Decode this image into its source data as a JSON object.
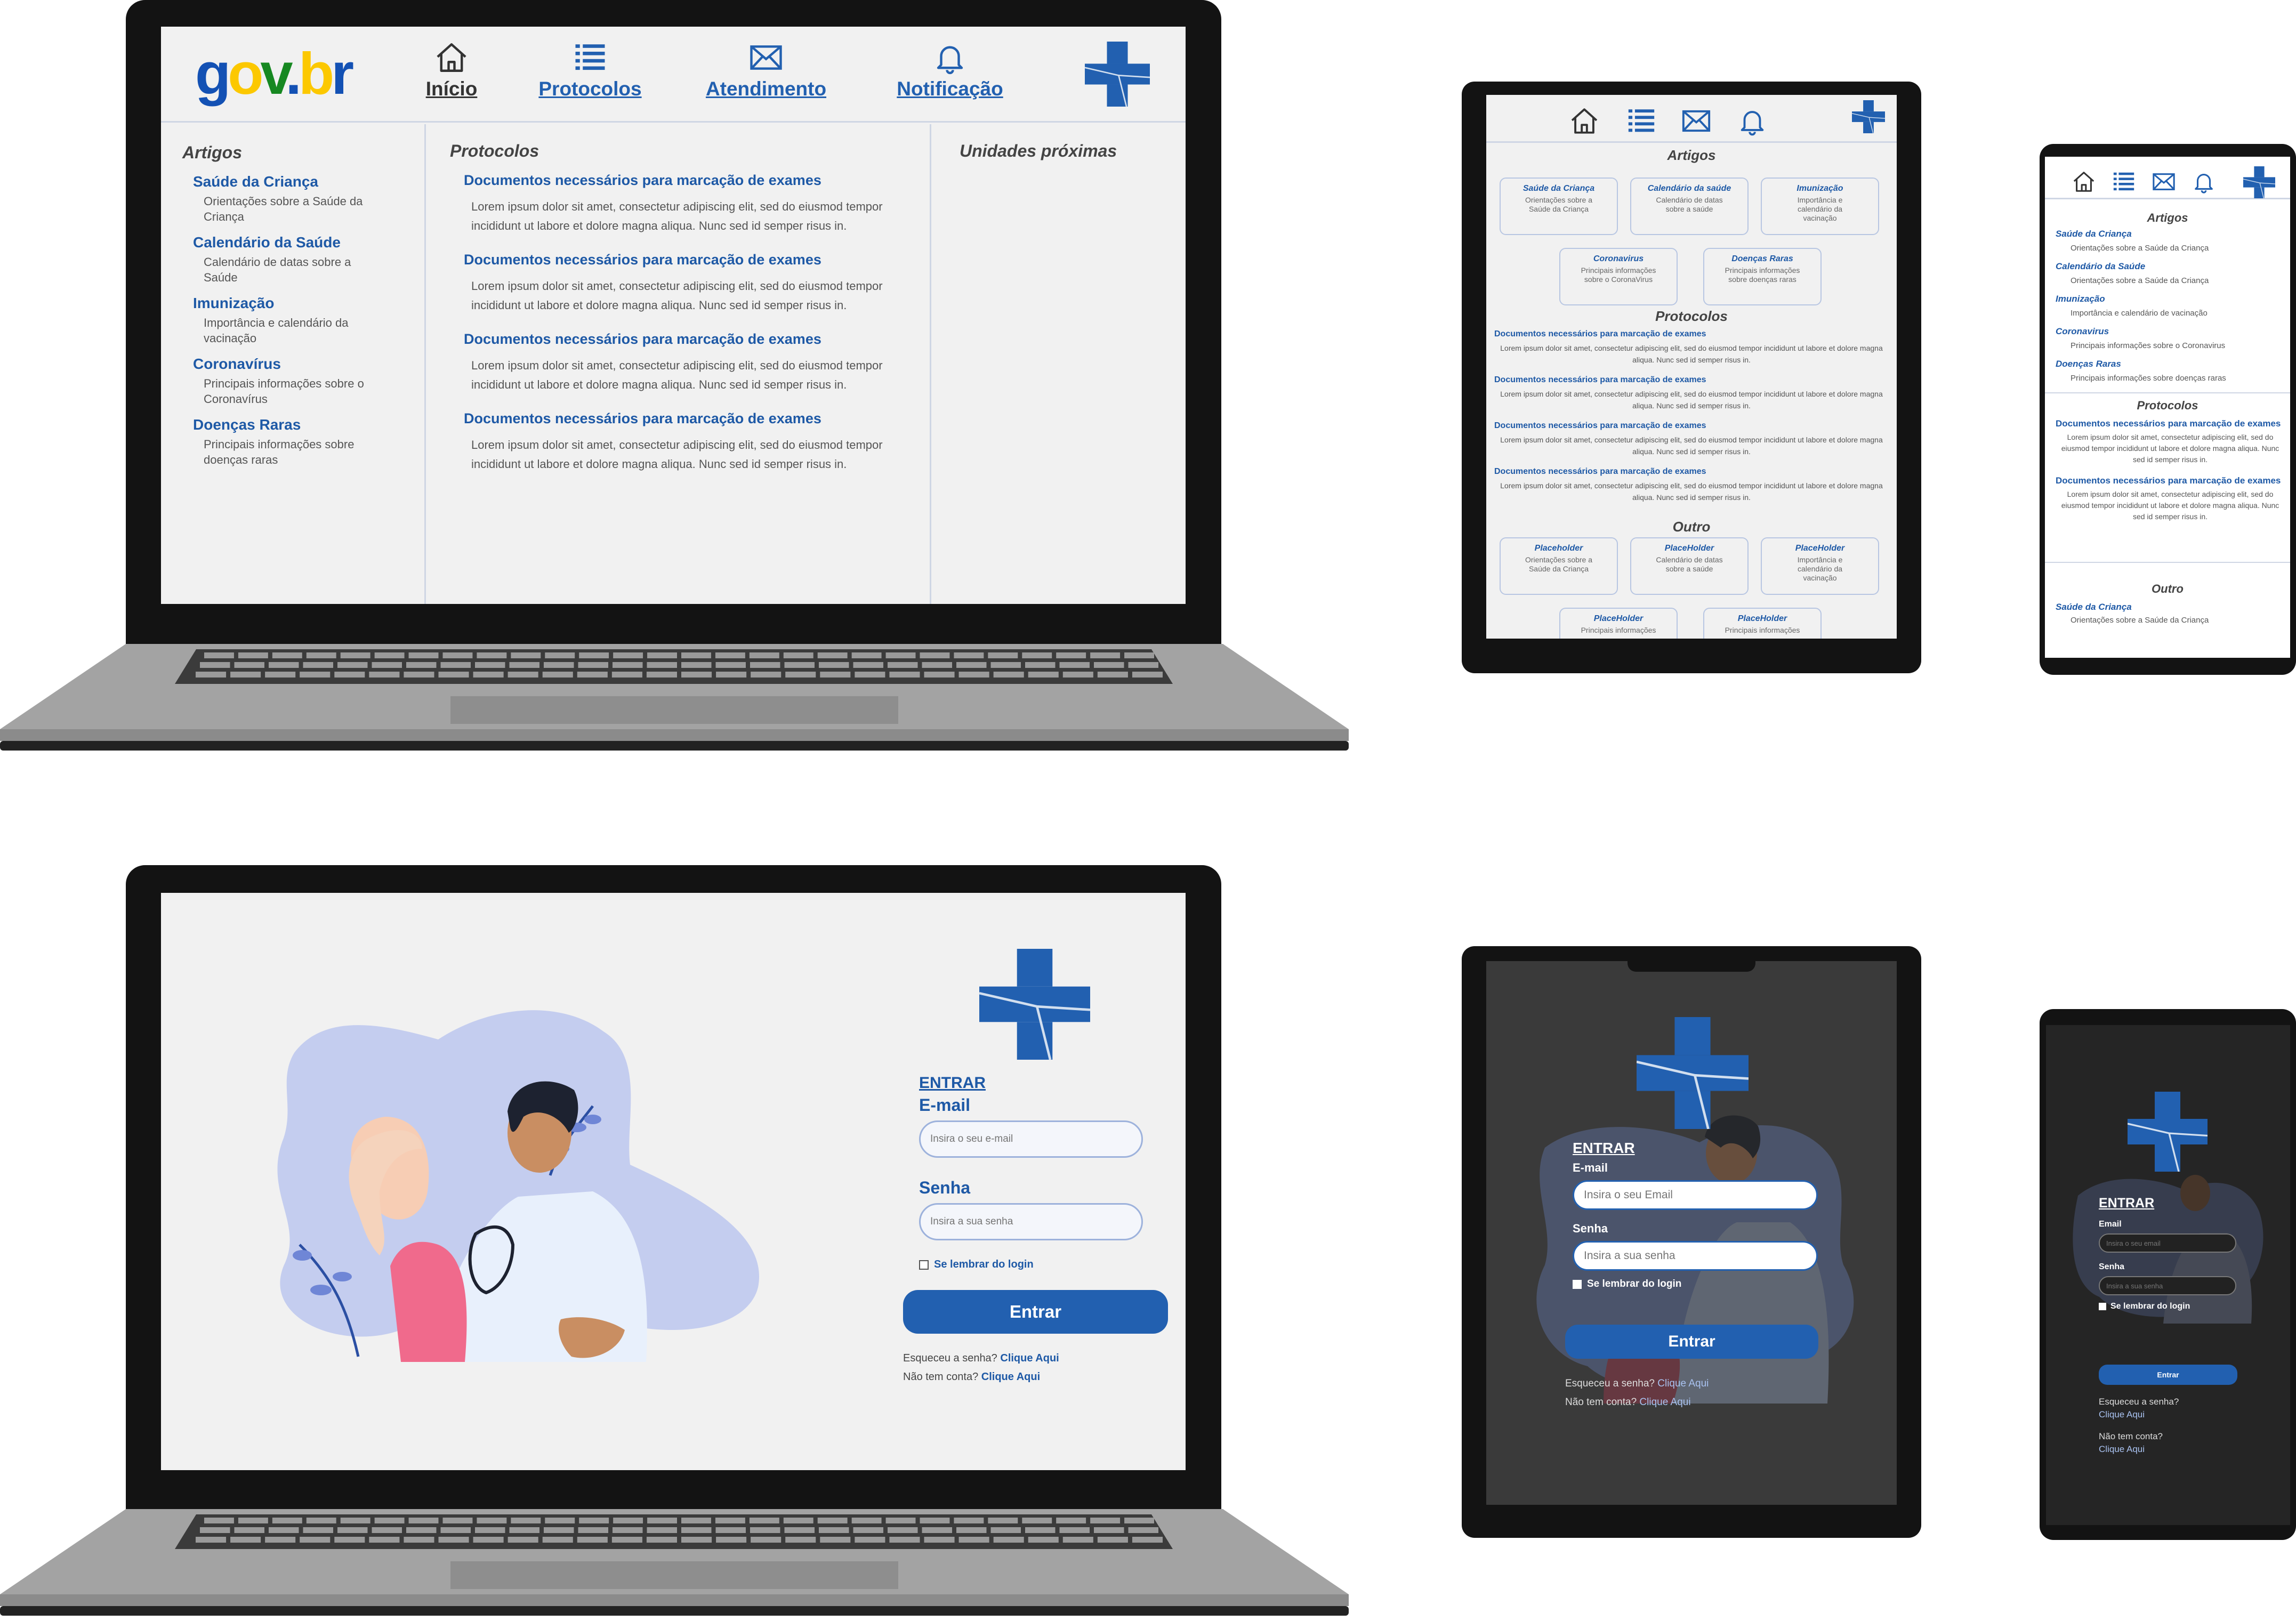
{
  "colors": {
    "brand_blue": "#2260b0",
    "link_blue": "#1e59a6",
    "screen_bg": "#f1f1f1",
    "device_black": "#131313",
    "laptop_gray": "#a1a1a1",
    "dark_screen": "#3b3b3b",
    "phone_dark": "#252525"
  },
  "icons": {
    "home": "home-icon",
    "list": "list-icon",
    "mail": "mail-icon",
    "bell": "bell-icon",
    "cross": "medical-cross-logo"
  },
  "header": {
    "logo": "gov.br",
    "nav": [
      {
        "label": "Início",
        "icon": "home-icon"
      },
      {
        "label": "Protocolos",
        "icon": "list-icon"
      },
      {
        "label": "Atendimento",
        "icon": "mail-icon"
      },
      {
        "label": "Notificação",
        "icon": "bell-icon"
      }
    ]
  },
  "desktop": {
    "articles_title": "Artigos",
    "articles": [
      {
        "title": "Saúde da Criança",
        "desc": "Orientações sobre a Saúde da Criança"
      },
      {
        "title": "Calendário da Saúde",
        "desc": "Calendário de datas sobre a Saúde"
      },
      {
        "title": "Imunização",
        "desc": "Importância e calendário da vacinação"
      },
      {
        "title": "Coronavírus",
        "desc": "Principais informações sobre o Coronavírus"
      },
      {
        "title": "Doenças Raras",
        "desc": "Principais informações sobre doenças raras"
      }
    ],
    "protocols_title": "Protocolos",
    "protocols": [
      {
        "title": "Documentos necessários para marcação de exames",
        "body": "Lorem ipsum dolor sit amet, consectetur adipiscing elit, sed do eiusmod tempor incididunt ut labore et dolore magna aliqua. Nunc sed id semper risus in."
      },
      {
        "title": "Documentos necessários para marcação de exames",
        "body": "Lorem ipsum dolor sit amet, consectetur adipiscing elit, sed do eiusmod tempor incididunt ut labore et dolore magna aliqua. Nunc sed id semper risus in."
      },
      {
        "title": "Documentos necessários para marcação de exames",
        "body": "Lorem ipsum dolor sit amet, consectetur adipiscing elit, sed do eiusmod tempor incididunt ut labore et dolore magna aliqua. Nunc sed id semper risus in."
      },
      {
        "title": "Documentos necessários para marcação de exames",
        "body": "Lorem ipsum dolor sit amet, consectetur adipiscing elit, sed do eiusmod tempor incididunt ut labore et dolore magna aliqua. Nunc sed id semper risus in."
      }
    ],
    "nearby_title": "Unidades próximas"
  },
  "tablet": {
    "articles_title": "Artigos",
    "cards": [
      {
        "title": "Saúde da Criança",
        "desc": "Orientações sobre a Saúde da Criança"
      },
      {
        "title": "Calendário da saúde",
        "desc": "Calendário de datas sobre a saúde"
      },
      {
        "title": "Imunização",
        "desc": "Importância e calendário da vacinação"
      },
      {
        "title": "Coronavirus",
        "desc": "Principais informações sobre o CoronaVirus"
      },
      {
        "title": "Doenças Raras",
        "desc": "Principais informações sobre doenças raras"
      }
    ],
    "protocols_title": "Protocolos",
    "protocol_title": "Documentos necessários para marcação de exames",
    "protocol_body": "Lorem ipsum dolor sit amet, consectetur adipiscing elit, sed do eiusmod tempor incididunt ut labore et dolore magna aliqua. Nunc sed id semper risus in.",
    "other_title": "Outro",
    "other_cards": [
      {
        "title": "Placeholder",
        "desc": "Orientações sobre a Saúde da Criança"
      },
      {
        "title": "PlaceHolder",
        "desc": "Calendário de datas sobre a saúde"
      },
      {
        "title": "PlaceHolder",
        "desc": "Importância e calendário da vacinação"
      },
      {
        "title": "PlaceHolder",
        "desc": "Principais informações"
      },
      {
        "title": "PlaceHolder",
        "desc": "Principais informações"
      }
    ]
  },
  "phone": {
    "articles_title": "Artigos",
    "articles": [
      {
        "title": "Saúde da Criança",
        "desc": "Orientações sobre a Saúde da Criança"
      },
      {
        "title": "Calendário da Saúde",
        "desc": "Orientações sobre a Saúde da Criança"
      },
      {
        "title": "Imunização",
        "desc": "Importância e calendário de vacinação"
      },
      {
        "title": "Coronavirus",
        "desc": "Principais informações sobre o Coronavirus"
      },
      {
        "title": "Doenças Raras",
        "desc": "Principais informações sobre doenças raras"
      }
    ],
    "protocols_title": "Protocolos",
    "protocol_title": "Documentos necessários para marcação de exames",
    "protocol_body": "Lorem ipsum dolor sit amet, consectetur adipiscing elit, sed do eiusmod tempor incididunt ut labore et dolore magna aliqua. Nunc sed id semper risus in.",
    "other_title": "Outro",
    "other_item": {
      "title": "Saúde da Criança",
      "desc": "Orientações sobre a Saúde da Criança"
    }
  },
  "login": {
    "title": "ENTRAR",
    "email_label": "E-mail",
    "email_placeholder": "Insira o seu e-mail",
    "password_label": "Senha",
    "password_placeholder": "Insira a sua senha",
    "remember": "Se lembrar do login",
    "submit": "Entrar",
    "forgot": "Esqueceu a senha?",
    "forgot_link": "Clique Aqui",
    "no_account": "Não tem conta?",
    "signup_link": "Clique Aqui"
  },
  "login_tablet": {
    "title": "ENTRAR",
    "email_label": "E-mail",
    "email_placeholder": "Insira o seu Email",
    "password_label": "Senha",
    "password_placeholder": "Insira a sua senha",
    "remember": "Se lembrar do login",
    "submit": "Entrar",
    "forgot": "Esqueceu a senha?",
    "forgot_link": "Clique Aqui",
    "no_account": "Não tem conta?",
    "signup_link": "Clique Aqui"
  },
  "login_phone": {
    "title": "ENTRAR",
    "email_label": "Email",
    "email_placeholder": "Insira o seu email",
    "password_label": "Senha",
    "password_placeholder": "Insira a sua senha",
    "remember": "Se lembrar do login",
    "submit": "Entrar",
    "forgot": "Esqueceu a senha?",
    "forgot_link": "Clique Aqui",
    "no_account": "Não tem conta?",
    "signup_link": "Clique Aqui"
  }
}
